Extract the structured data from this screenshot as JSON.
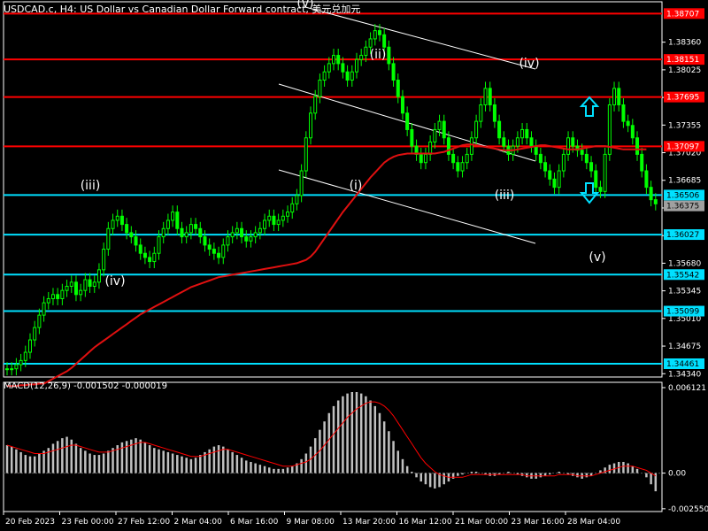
{
  "header": {
    "title": "USDCAD.c, H4: US Dollar vs Canadian Dollar Forward contract, 美元兑加元"
  },
  "colors": {
    "background": "#000000",
    "grid": "#2a2a2a",
    "candles": "#00ff00",
    "ma": "#e01010",
    "resistance": "#ff0000",
    "support": "#00e0ff",
    "channel": "#ffffff",
    "macd_hist": "#c0c0c0",
    "macd_signal": "#ff0000",
    "arrow_up": "#00e0ff",
    "arrow_down": "#00e0ff",
    "label_text": "#ffffff",
    "current_price_box": "#a0a0a0"
  },
  "icons": {
    "up_arrow": "hollow-up-arrow-icon",
    "down_arrow": "hollow-down-arrow-icon"
  },
  "chart_data": {
    "type": "candlestick",
    "symbol": "USDCAD.c",
    "timeframe": "H4",
    "price_axis": {
      "range": [
        1.343,
        1.3885
      ],
      "ticks": [
        "1.38360",
        "1.38025",
        "1.37690",
        "1.37355",
        "1.37020",
        "1.36685",
        "1.36350",
        "1.36015",
        "1.35680",
        "1.35345",
        "1.35010",
        "1.34675",
        "1.34340"
      ]
    },
    "time_axis": {
      "labels": [
        "20 Feb 2023",
        "23 Feb 00:00",
        "27 Feb 12:00",
        "2 Mar 04:00",
        "6 Mar 16:00",
        "9 Mar 08:00",
        "13 Mar 20:00",
        "16 Mar 12:00",
        "21 Mar 00:00",
        "23 Mar 16:00",
        "28 Mar 04:00"
      ]
    },
    "horizontal_levels": {
      "resistance": [
        {
          "value": 1.38707,
          "label": "1.38707"
        },
        {
          "value": 1.38151,
          "label": "1.38151"
        },
        {
          "value": 1.37695,
          "label": "1.37695"
        },
        {
          "value": 1.37097,
          "label": "1.37097"
        }
      ],
      "support": [
        {
          "value": 1.36506,
          "label": "1.36506"
        },
        {
          "value": 1.36027,
          "label": "1.36027"
        },
        {
          "value": 1.35542,
          "label": "1.35542"
        },
        {
          "value": 1.35099,
          "label": "1.35099"
        },
        {
          "value": 1.34461,
          "label": "1.34461"
        }
      ]
    },
    "current_price": {
      "value": 1.36375,
      "label": "1.36375"
    },
    "wave_labels": [
      "(iii)",
      "(iv)",
      "(v)",
      "(ii)",
      "(iv)",
      "(i)",
      "(iii)",
      "(v)"
    ],
    "indicator": {
      "name": "MACD(12,26,9)",
      "macd": "-0.001502",
      "signal": "-0.000019",
      "label": "MACD(12,26,9) -0.001502 -0.000019",
      "axis_ticks": [
        "0.006121",
        "0.00",
        "-0.002550"
      ],
      "range": [
        -0.00275,
        0.0065
      ],
      "histogram": [
        0.002,
        0.0019,
        0.0017,
        0.0015,
        0.0013,
        0.0012,
        0.0012,
        0.0014,
        0.0016,
        0.0018,
        0.0021,
        0.0023,
        0.0025,
        0.0026,
        0.0024,
        0.0021,
        0.0018,
        0.0016,
        0.0014,
        0.0013,
        0.0013,
        0.0014,
        0.0016,
        0.0018,
        0.002,
        0.0022,
        0.0023,
        0.0024,
        0.0025,
        0.0024,
        0.0022,
        0.002,
        0.0018,
        0.0017,
        0.0016,
        0.0015,
        0.0014,
        0.0013,
        0.0012,
        0.0011,
        0.001,
        0.0011,
        0.0013,
        0.0015,
        0.0017,
        0.0019,
        0.002,
        0.0019,
        0.0017,
        0.0015,
        0.0013,
        0.0011,
        0.0009,
        0.0008,
        0.0007,
        0.0006,
        0.0005,
        0.0004,
        0.0003,
        0.0003,
        0.0003,
        0.0004,
        0.0005,
        0.0007,
        0.001,
        0.0014,
        0.0019,
        0.0025,
        0.0031,
        0.0037,
        0.0043,
        0.0048,
        0.0052,
        0.0055,
        0.0057,
        0.0058,
        0.0058,
        0.0057,
        0.0055,
        0.0052,
        0.0048,
        0.0043,
        0.0037,
        0.003,
        0.0023,
        0.0016,
        0.001,
        0.0005,
        0.0001,
        -0.0003,
        -0.0006,
        -0.0008,
        -0.001,
        -0.0011,
        -0.001,
        -0.0008,
        -0.0006,
        -0.0004,
        -0.0002,
        -0.0001,
        0.0,
        0.0001,
        0.0001,
        0.0,
        -0.0001,
        -0.0002,
        -0.0002,
        -0.0001,
        0.0,
        0.0001,
        0.0,
        -0.0001,
        -0.0002,
        -0.0003,
        -0.0004,
        -0.0004,
        -0.0003,
        -0.0002,
        -0.0001,
        0.0,
        0.0001,
        0.0,
        -0.0001,
        -0.0002,
        -0.0003,
        -0.0004,
        -0.0003,
        -0.0002,
        0.0,
        0.0002,
        0.0004,
        0.0006,
        0.0007,
        0.0008,
        0.0008,
        0.0007,
        0.0005,
        0.0003,
        0.0,
        -0.0003,
        -0.0008,
        -0.0013
      ]
    },
    "series": [
      {
        "name": "MA",
        "values": [
          1.3419,
          1.3419,
          1.3419,
          1.342,
          1.342,
          1.3421,
          1.3421,
          1.3422,
          1.3422,
          1.3425,
          1.3428,
          1.3431,
          1.3434,
          1.3437,
          1.3441,
          1.3446,
          1.3451,
          1.3456,
          1.3461,
          1.3466,
          1.347,
          1.3474,
          1.3478,
          1.3482,
          1.3486,
          1.349,
          1.3494,
          1.3498,
          1.3502,
          1.3506,
          1.3509,
          1.3512,
          1.3515,
          1.3518,
          1.3521,
          1.3524,
          1.3527,
          1.353,
          1.3533,
          1.3536,
          1.3539,
          1.3541,
          1.3543,
          1.3545,
          1.3547,
          1.3549,
          1.3551,
          1.3552,
          1.3553,
          1.3554,
          1.3555,
          1.3556,
          1.3557,
          1.3558,
          1.3559,
          1.356,
          1.3561,
          1.3562,
          1.3563,
          1.3564,
          1.3565,
          1.3566,
          1.3567,
          1.3568,
          1.357,
          1.3572,
          1.3576,
          1.3582,
          1.359,
          1.3598,
          1.3606,
          1.3614,
          1.3622,
          1.363,
          1.3637,
          1.3644,
          1.3651,
          1.3658,
          1.3665,
          1.3672,
          1.3678,
          1.3684,
          1.369,
          1.3694,
          1.3697,
          1.3699,
          1.37,
          1.3701,
          1.3701,
          1.3701,
          1.3701,
          1.3701,
          1.3701,
          1.3701,
          1.3702,
          1.3703,
          1.3705,
          1.3707,
          1.3709,
          1.3711,
          1.3712,
          1.3712,
          1.3711,
          1.371,
          1.3709,
          1.3708,
          1.3707,
          1.3706,
          1.3705,
          1.3705,
          1.3705,
          1.3706,
          1.3707,
          1.3708,
          1.3709,
          1.371,
          1.3711,
          1.3711,
          1.371,
          1.3709,
          1.3708,
          1.3707,
          1.3706,
          1.3706,
          1.3706,
          1.3707,
          1.3708,
          1.3709,
          1.371,
          1.371,
          1.371,
          1.3709,
          1.3708,
          1.3707,
          1.3706,
          1.3706,
          1.3706,
          1.3706,
          1.3706,
          1.3706
        ]
      },
      {
        "name": "MACD signal",
        "values": [
          0.002,
          0.0019,
          0.0018,
          0.0017,
          0.0016,
          0.0015,
          0.0014,
          0.0014,
          0.0014,
          0.0015,
          0.0016,
          0.0017,
          0.0018,
          0.0019,
          0.002,
          0.002,
          0.0019,
          0.0018,
          0.0017,
          0.0016,
          0.0015,
          0.0015,
          0.0015,
          0.0016,
          0.0017,
          0.0018,
          0.0019,
          0.002,
          0.0021,
          0.0022,
          0.0022,
          0.0021,
          0.002,
          0.0019,
          0.0018,
          0.0017,
          0.0016,
          0.0015,
          0.0014,
          0.0013,
          0.0012,
          0.0012,
          0.0012,
          0.0013,
          0.0014,
          0.0015,
          0.0016,
          0.0017,
          0.0017,
          0.0016,
          0.0015,
          0.0014,
          0.0013,
          0.0012,
          0.0011,
          0.001,
          0.0009,
          0.0008,
          0.0007,
          0.0006,
          0.0005,
          0.0005,
          0.0005,
          0.0006,
          0.0007,
          0.0008,
          0.001,
          0.0013,
          0.0016,
          0.002,
          0.0024,
          0.0028,
          0.0032,
          0.0036,
          0.004,
          0.0043,
          0.0046,
          0.0048,
          0.005,
          0.0051,
          0.0051,
          0.005,
          0.0048,
          0.0045,
          0.0041,
          0.0036,
          0.0031,
          0.0026,
          0.0021,
          0.0016,
          0.0011,
          0.0007,
          0.0004,
          0.0001,
          -0.0001,
          -0.0002,
          -0.0003,
          -0.0003,
          -0.0003,
          -0.0003,
          -0.0002,
          -0.0001,
          -0.0001,
          -0.0001,
          -0.0001,
          -0.0001,
          -0.0001,
          -0.0001,
          -0.0001,
          -0.0001,
          -0.0001,
          -0.0001,
          -0.0001,
          -0.0002,
          -0.0002,
          -0.0002,
          -0.0002,
          -0.0002,
          -0.0002,
          -0.0002,
          -0.0001,
          -0.0001,
          -0.0001,
          -0.0001,
          -0.0002,
          -0.0002,
          -0.0002,
          -0.0002,
          -0.0001,
          0.0,
          0.0001,
          0.0002,
          0.0003,
          0.0004,
          0.0005,
          0.0005,
          0.0005,
          0.0004,
          0.0003,
          0.0002,
          0.0,
          -0.0002
        ]
      }
    ],
    "candles_close": [
      1.344,
      1.344,
      1.3445,
      1.345,
      1.346,
      1.3475,
      1.349,
      1.3505,
      1.352,
      1.3525,
      1.353,
      1.3525,
      1.3535,
      1.354,
      1.3545,
      1.353,
      1.3535,
      1.3548,
      1.354,
      1.3545,
      1.356,
      1.3585,
      1.361,
      1.362,
      1.3625,
      1.3615,
      1.3605,
      1.36,
      1.359,
      1.358,
      1.3575,
      1.357,
      1.358,
      1.36,
      1.361,
      1.362,
      1.363,
      1.361,
      1.36,
      1.3605,
      1.3615,
      1.361,
      1.36,
      1.359,
      1.3585,
      1.358,
      1.3575,
      1.359,
      1.36,
      1.3605,
      1.361,
      1.36,
      1.3595,
      1.36,
      1.3605,
      1.361,
      1.362,
      1.3625,
      1.3615,
      1.362,
      1.3625,
      1.363,
      1.364,
      1.365,
      1.368,
      1.372,
      1.375,
      1.377,
      1.379,
      1.38,
      1.381,
      1.382,
      1.381,
      1.38,
      1.379,
      1.38,
      1.3815,
      1.382,
      1.383,
      1.384,
      1.385,
      1.3845,
      1.383,
      1.381,
      1.379,
      1.377,
      1.375,
      1.373,
      1.371,
      1.37,
      1.369,
      1.37,
      1.3715,
      1.373,
      1.374,
      1.372,
      1.37,
      1.369,
      1.368,
      1.369,
      1.37,
      1.372,
      1.374,
      1.376,
      1.378,
      1.376,
      1.374,
      1.372,
      1.371,
      1.37,
      1.371,
      1.372,
      1.373,
      1.372,
      1.371,
      1.37,
      1.369,
      1.368,
      1.367,
      1.366,
      1.368,
      1.37,
      1.372,
      1.371,
      1.3705,
      1.37,
      1.369,
      1.368,
      1.366,
      1.3655,
      1.37,
      1.376,
      1.378,
      1.376,
      1.374,
      1.3735,
      1.372,
      1.37,
      1.368,
      1.366,
      1.3645,
      1.364
    ]
  },
  "axis_right_labels_note": ""
}
